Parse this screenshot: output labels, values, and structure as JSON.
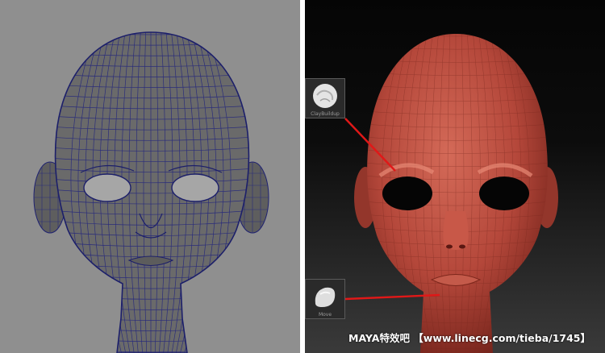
{
  "left_viewport": {
    "background": "#8f8f8f",
    "mesh_fill": "#6a6a6a",
    "wire_color": "#2b2d7a"
  },
  "right_viewport": {
    "mesh_fill": "#b84a3a",
    "callout_color": "#e01818",
    "brushes": [
      {
        "icon": "claybuildup-brush-icon",
        "label": "ClayBuildup"
      },
      {
        "icon": "move-brush-icon",
        "label": "Move"
      }
    ]
  },
  "watermark": {
    "text": "MAYA特效吧 【www.linecg.com/tieba/1745】"
  }
}
